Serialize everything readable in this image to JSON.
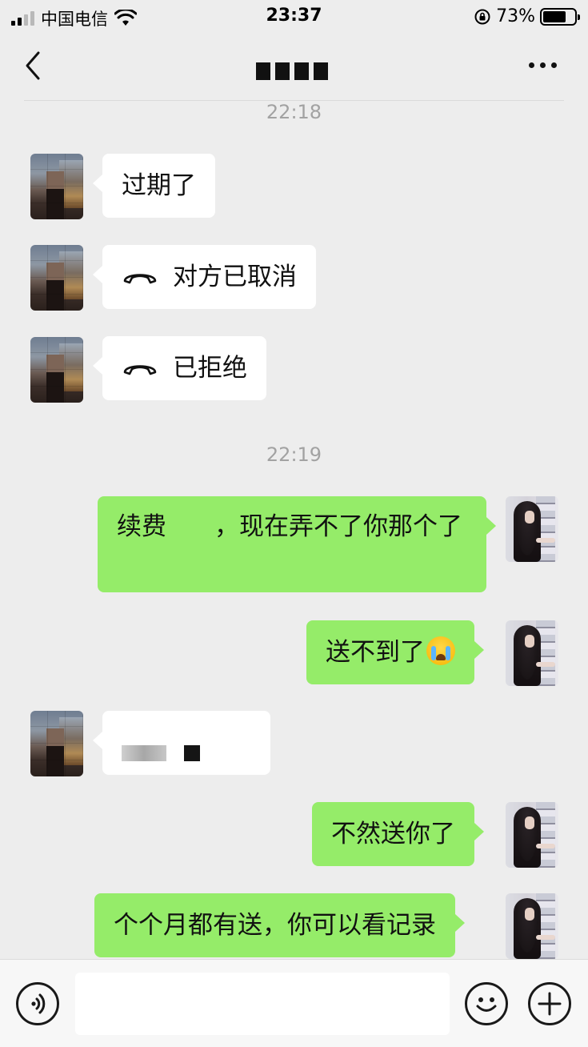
{
  "status_bar": {
    "carrier": "中国电信",
    "time": "23:37",
    "battery_percent": "73%",
    "battery_level": 0.73,
    "signal_bars": 2
  },
  "nav": {
    "back_icon": "chevron-left-icon",
    "more_icon": "more-dots-icon"
  },
  "messages": {
    "ts1": "22:18",
    "m1": "过期了",
    "m2": "对方已取消",
    "m3": "已拒绝",
    "ts2": "22:19",
    "m4a": "续费",
    "m4b": "，现在弄不了你那个了",
    "m5": "送不到了",
    "m7": "不然送你了",
    "m8": "个个月都有送，你可以看记录"
  },
  "colors": {
    "background": "#ededed",
    "sent_bubble": "#95ec69",
    "received_bubble": "#ffffff",
    "timestamp": "#a2a2a2"
  },
  "input_bar": {
    "value": "",
    "voice_icon": "voice-icon",
    "emoji_icon": "emoji-icon",
    "plus_icon": "plus-icon"
  }
}
